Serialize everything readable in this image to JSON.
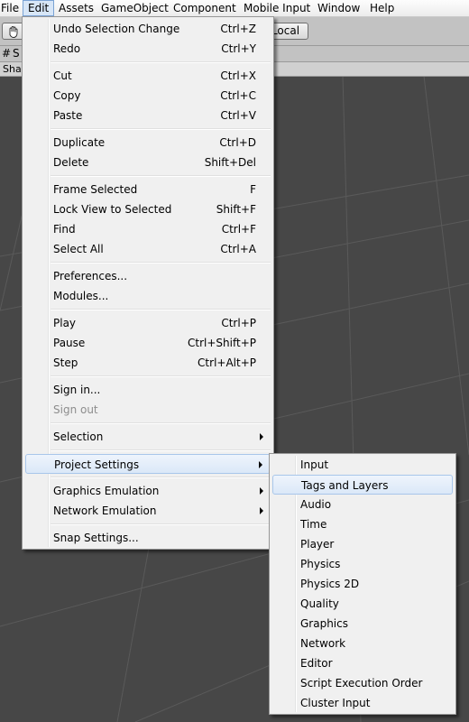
{
  "menubar": {
    "items": [
      "File",
      "Edit",
      "Assets",
      "GameObject",
      "Component",
      "Mobile Input",
      "Window",
      "Help"
    ],
    "active": "Edit"
  },
  "toolbar": {
    "hand_tool": "hand-tool-icon",
    "local_label": "Local"
  },
  "scene_tab": {
    "label": "S",
    "shaded_label": "Shad"
  },
  "edit_menu": {
    "groups": [
      [
        {
          "label": "Undo Selection Change",
          "shortcut": "Ctrl+Z"
        },
        {
          "label": "Redo",
          "shortcut": "Ctrl+Y"
        }
      ],
      [
        {
          "label": "Cut",
          "shortcut": "Ctrl+X"
        },
        {
          "label": "Copy",
          "shortcut": "Ctrl+C"
        },
        {
          "label": "Paste",
          "shortcut": "Ctrl+V"
        }
      ],
      [
        {
          "label": "Duplicate",
          "shortcut": "Ctrl+D"
        },
        {
          "label": "Delete",
          "shortcut": "Shift+Del"
        }
      ],
      [
        {
          "label": "Frame Selected",
          "shortcut": "F"
        },
        {
          "label": "Lock View to Selected",
          "shortcut": "Shift+F"
        },
        {
          "label": "Find",
          "shortcut": "Ctrl+F"
        },
        {
          "label": "Select All",
          "shortcut": "Ctrl+A"
        }
      ],
      [
        {
          "label": "Preferences...",
          "shortcut": ""
        },
        {
          "label": "Modules...",
          "shortcut": ""
        }
      ],
      [
        {
          "label": "Play",
          "shortcut": "Ctrl+P"
        },
        {
          "label": "Pause",
          "shortcut": "Ctrl+Shift+P"
        },
        {
          "label": "Step",
          "shortcut": "Ctrl+Alt+P"
        }
      ],
      [
        {
          "label": "Sign in...",
          "shortcut": ""
        },
        {
          "label": "Sign out",
          "shortcut": "",
          "disabled": true
        }
      ],
      [
        {
          "label": "Selection",
          "shortcut": "",
          "submenu": true
        }
      ],
      [
        {
          "label": "Project Settings",
          "shortcut": "",
          "submenu": true,
          "highlighted": true
        }
      ],
      [
        {
          "label": "Graphics Emulation",
          "shortcut": "",
          "submenu": true
        },
        {
          "label": "Network Emulation",
          "shortcut": "",
          "submenu": true
        }
      ],
      [
        {
          "label": "Snap Settings...",
          "shortcut": ""
        }
      ]
    ]
  },
  "project_settings_menu": {
    "items": [
      {
        "label": "Input"
      },
      {
        "label": "Tags and Layers",
        "highlighted": true
      },
      {
        "label": "Audio"
      },
      {
        "label": "Time"
      },
      {
        "label": "Player"
      },
      {
        "label": "Physics"
      },
      {
        "label": "Physics 2D"
      },
      {
        "label": "Quality"
      },
      {
        "label": "Graphics"
      },
      {
        "label": "Network"
      },
      {
        "label": "Editor"
      },
      {
        "label": "Script Execution Order"
      },
      {
        "label": "Cluster Input"
      }
    ]
  }
}
